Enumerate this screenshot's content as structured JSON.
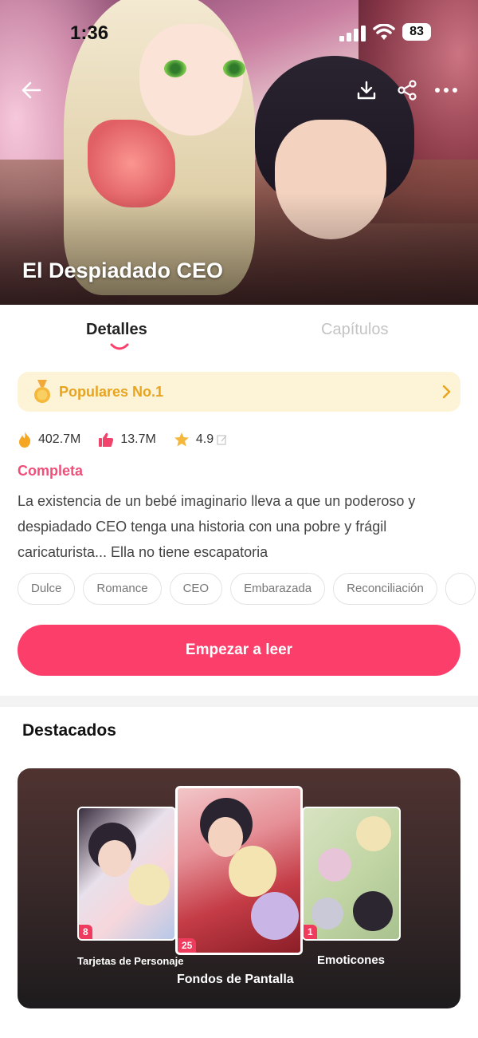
{
  "status_bar": {
    "time": "1:36",
    "battery": "83"
  },
  "hero": {
    "title": "El Despiadado CEO"
  },
  "tabs": [
    {
      "label": "Detalles",
      "active": true
    },
    {
      "label": "Capítulos",
      "active": false
    }
  ],
  "popular": {
    "label": "Populares No.1"
  },
  "stats": {
    "views": "402.7M",
    "likes": "13.7M",
    "rating": "4.9"
  },
  "book": {
    "status": "Completa",
    "synopsis": "La existencia de un bebé imaginario lleva a que un poderoso y despiadado CEO tenga una historia con una pobre y frágil caricaturista... Ella no tiene escapatoria"
  },
  "tags": [
    "Dulce",
    "Romance",
    "CEO",
    "Embarazada",
    "Reconciliación"
  ],
  "start_button": "Empezar a leer",
  "featured": {
    "title": "Destacados",
    "items": [
      {
        "caption": "Tarjetas de Personaje",
        "count": "8"
      },
      {
        "caption": "Fondos de Pantalla",
        "count": "25"
      },
      {
        "caption": "Emoticones",
        "count": "1"
      }
    ]
  },
  "colors": {
    "accent": "#fb3f6a",
    "status": "#ef4f79",
    "gold": "#e9a41f",
    "popular_bg": "#fdf3d6"
  }
}
